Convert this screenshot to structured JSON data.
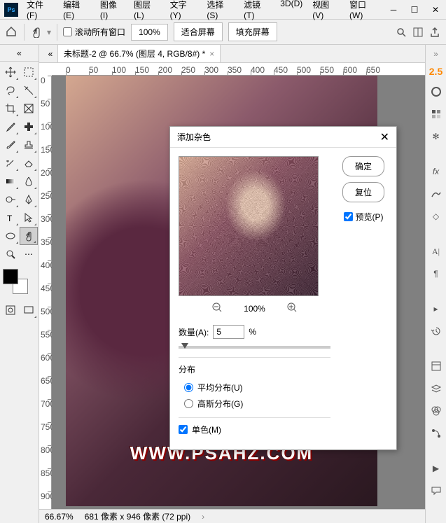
{
  "menu": {
    "file": "文件(F)",
    "edit": "编辑(E)",
    "image": "图像(I)",
    "layer": "图层(L)",
    "type": "文字(Y)",
    "select": "选择(S)",
    "filter": "滤镜(T)",
    "3d": "3D(D)",
    "view": "视图(V)",
    "window": "窗口(W)"
  },
  "options": {
    "scroll_all": "滚动所有窗口",
    "zoom": "100%",
    "fit": "适合屏幕",
    "fill": "填充屏幕"
  },
  "doc": {
    "tab_title": "未标题-2 @ 66.7% (图层 4, RGB/8#) *"
  },
  "ruler_h": [
    "0",
    "50",
    "100",
    "150",
    "200",
    "250",
    "300",
    "350",
    "400",
    "450",
    "500",
    "550",
    "600",
    "650"
  ],
  "ruler_v": [
    "0",
    "50",
    "100",
    "150",
    "200",
    "250",
    "300",
    "350",
    "400",
    "450",
    "500",
    "550",
    "600",
    "650",
    "700",
    "750",
    "800",
    "850",
    "900"
  ],
  "watermark": "WWW.PSAHZ.COM",
  "status": {
    "zoom": "66.67%",
    "dims": "681 像素 x 946 像素 (72 ppi)"
  },
  "panel_number": "2.5",
  "dialog": {
    "title": "添加杂色",
    "ok": "确定",
    "reset": "复位",
    "preview": "预览(P)",
    "zoom": "100%",
    "amount_label": "数量(A):",
    "amount_value": "5",
    "amount_unit": "%",
    "dist_title": "分布",
    "uniform": "平均分布(U)",
    "gaussian": "高斯分布(G)",
    "mono": "单色(M)"
  }
}
